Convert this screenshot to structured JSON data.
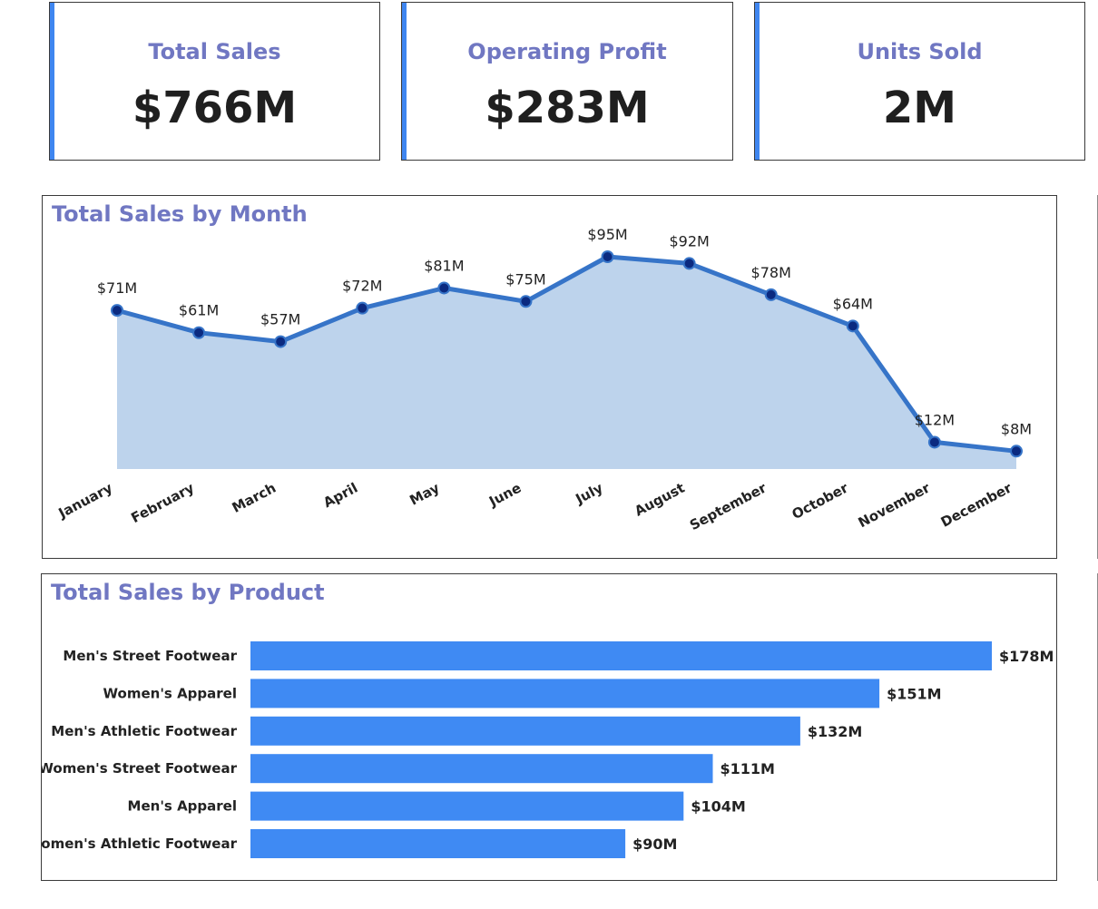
{
  "colors": {
    "accent": "#3f86f0",
    "title": "#7077c2",
    "line": "#3674c8",
    "area": "#bdd3ec",
    "marker": "#0b2a80",
    "bar": "#3f8af3"
  },
  "kpis": {
    "total_sales": {
      "label": "Total Sales",
      "value": "$766M"
    },
    "operating_profit": {
      "label": "Operating Profit",
      "value": "$283M"
    },
    "units_sold": {
      "label": "Units Sold",
      "value": "2M"
    }
  },
  "chart_data": [
    {
      "type": "area",
      "title": "Total Sales by Month",
      "categories": [
        "January",
        "February",
        "March",
        "April",
        "May",
        "June",
        "July",
        "August",
        "September",
        "October",
        "November",
        "December"
      ],
      "values": [
        71,
        61,
        57,
        72,
        81,
        75,
        95,
        92,
        78,
        64,
        12,
        8
      ],
      "data_labels": [
        "$71M",
        "$61M",
        "$57M",
        "$72M",
        "$81M",
        "$75M",
        "$95M",
        "$92M",
        "$78M",
        "$64M",
        "$12M",
        "$8M"
      ],
      "ylim": [
        0,
        95
      ],
      "grid": false,
      "legend": "none"
    },
    {
      "type": "bar",
      "orientation": "horizontal",
      "title": "Total Sales by Product",
      "categories": [
        "Men's Street Footwear",
        "Women's Apparel",
        "Men's Athletic Footwear",
        "Women's Street Footwear",
        "Men's Apparel",
        "Women's Athletic Footwear"
      ],
      "values": [
        178,
        151,
        132,
        111,
        104,
        90
      ],
      "data_labels": [
        "$178M",
        "$151M",
        "$132M",
        "$111M",
        "$104M",
        "$90M"
      ],
      "xlim": [
        0,
        178
      ],
      "grid": false,
      "legend": "none"
    }
  ]
}
